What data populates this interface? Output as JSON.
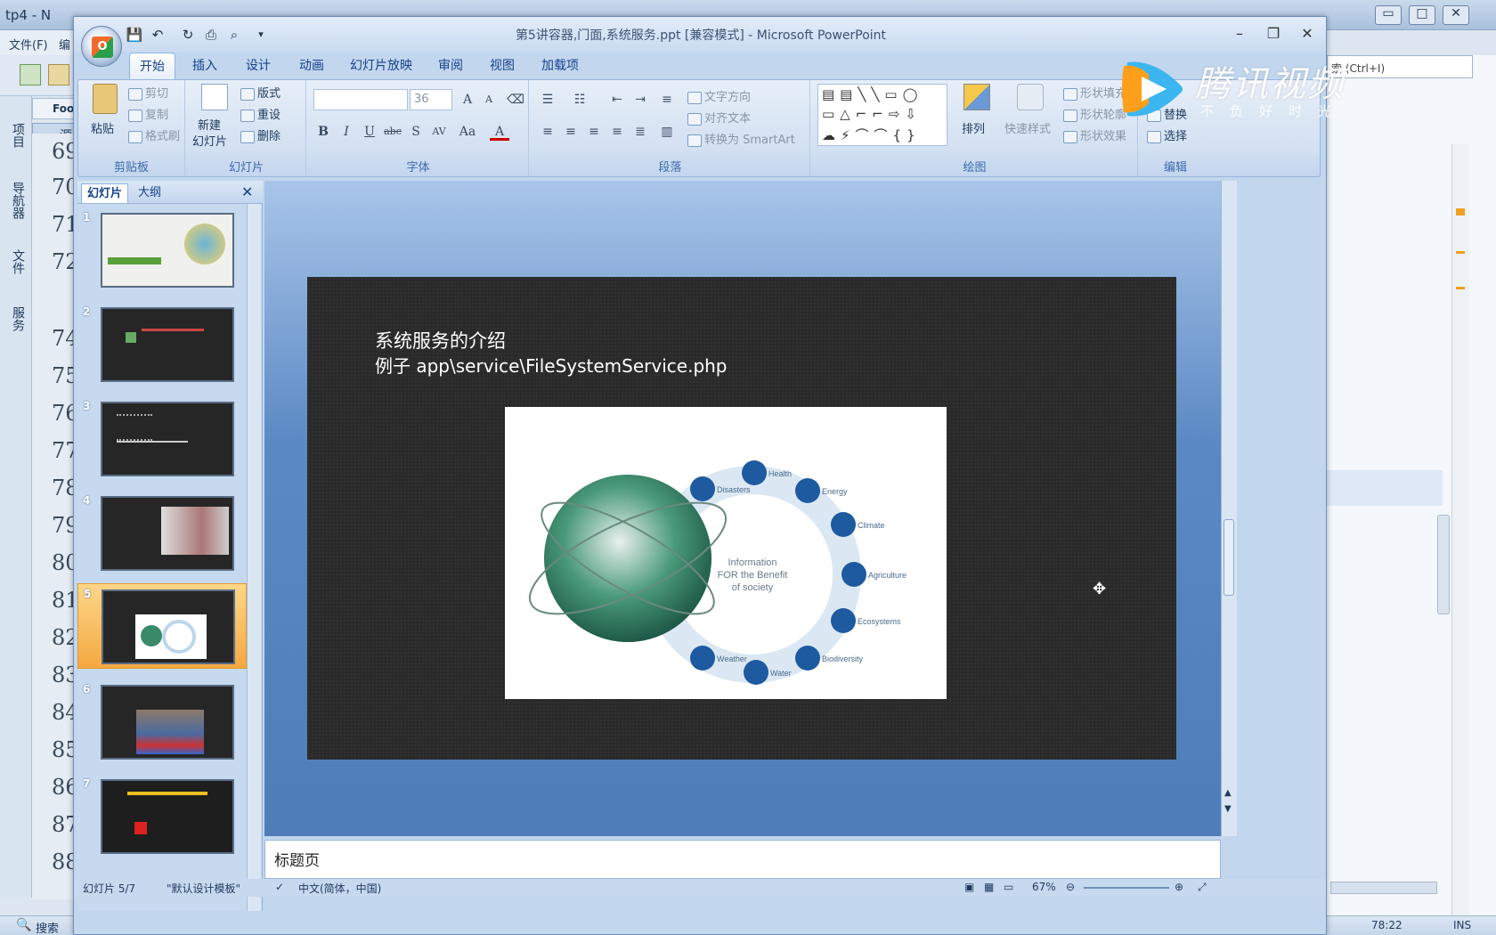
{
  "bg": {
    "title": "tp4 - N",
    "menu_file": "文件(F)",
    "menu_edit": "编",
    "foo_tab": "Foo",
    "src_tab": "源",
    "side_tabs": [
      "项目",
      "导航器",
      "文件",
      "服务"
    ],
    "line_numbers": [
      "69",
      "70",
      "71",
      "72",
      "74",
      "75",
      "76",
      "77",
      "78",
      "79",
      "80",
      "81",
      "82",
      "83",
      "84",
      "85",
      "86",
      "87",
      "88"
    ],
    "search_placeholder": "索 (Ctrl+I)",
    "status_pos": "78:22",
    "status_ins": "INS",
    "search_label": "搜索"
  },
  "ppt": {
    "title": "第5讲容器,门面,系统服务.ppt [兼容模式] - Microsoft PowerPoint",
    "tabs": [
      "开始",
      "插入",
      "设计",
      "动画",
      "幻灯片放映",
      "审阅",
      "视图",
      "加载项"
    ],
    "groups": {
      "clipboard": {
        "label": "剪贴板",
        "paste": "粘贴",
        "cut": "剪切",
        "copy": "复制",
        "format_painter": "格式刷"
      },
      "slides": {
        "label": "幻灯片",
        "new_slide_1": "新建",
        "new_slide_2": "幻灯片",
        "layout": "版式",
        "reset": "重设",
        "delete": "删除"
      },
      "font": {
        "label": "字体",
        "size": "36"
      },
      "paragraph": {
        "label": "段落",
        "text_direction": "文字方向",
        "align_text": "对齐文本",
        "smartart": "转换为 SmartArt"
      },
      "drawing": {
        "label": "绘图",
        "arrange": "排列",
        "quick_styles": "快速样式",
        "shape_fill": "形状填充",
        "shape_outline": "形状轮廓",
        "shape_effects": "形状效果"
      },
      "editing": {
        "label": "编辑",
        "replace": "替换",
        "select": "选择"
      }
    },
    "pane_tabs": [
      "幻灯片",
      "大纲"
    ],
    "slide_numbers": [
      "1",
      "2",
      "3",
      "4",
      "5",
      "6",
      "7"
    ],
    "selected_slide": 5,
    "slide": {
      "line1": "系统服务的介绍",
      "line2": "例子 app\\service\\FileSystemService.php",
      "center_1": "Information",
      "center_2": "FOR the Benefit",
      "center_3": "of society",
      "ring_labels": [
        "Disasters",
        "Health",
        "Energy",
        "Climate",
        "Agriculture",
        "Ecosystems",
        "Biodiversity",
        "Water",
        "Weather"
      ]
    },
    "notes": "标题页",
    "status": {
      "slide": "幻灯片 5/7",
      "theme": "\"默认设计模板\"",
      "lang": "中文(简体，中国)",
      "zoom": "67%"
    }
  },
  "watermark": {
    "brand": "腾讯视频",
    "slogan": "不负好时光"
  },
  "colors": {
    "accent": "#15428b",
    "ribbon": "#d3e1f2",
    "slide_bg": "#2a2a2a",
    "selected": "#f5a840"
  }
}
